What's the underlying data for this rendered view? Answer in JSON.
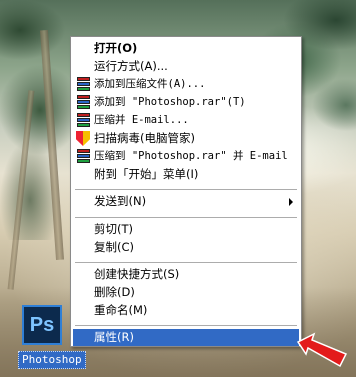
{
  "desktop": {
    "icon": {
      "label": "Photoshop",
      "glyph": "Ps",
      "tile_color": "#0c2a4d",
      "accent": "#2f7fd6"
    }
  },
  "context_menu": {
    "selected_bg": "#316ac5",
    "items": [
      {
        "label": "打开(O)",
        "bold": true,
        "icon": null
      },
      {
        "label": "运行方式(A)...",
        "icon": null
      },
      {
        "label": "添加到压缩文件(A)...",
        "icon": "winrar-icon"
      },
      {
        "label": "添加到 \"Photoshop.rar\"(T)",
        "icon": "winrar-icon"
      },
      {
        "label": "压缩并 E-mail...",
        "icon": "winrar-icon"
      },
      {
        "label": "扫描病毒(电脑管家)",
        "icon": "shield-icon"
      },
      {
        "label": "压缩到 \"Photoshop.rar\" 并 E-mail",
        "icon": "winrar-icon"
      },
      {
        "label": "附到「开始」菜单(I)",
        "icon": null
      },
      {
        "label": "发送到(N)",
        "icon": null,
        "submenu": true
      },
      {
        "label": "剪切(T)",
        "icon": null
      },
      {
        "label": "复制(C)",
        "icon": null
      },
      {
        "label": "创建快捷方式(S)",
        "icon": null
      },
      {
        "label": "删除(D)",
        "icon": null
      },
      {
        "label": "重命名(M)",
        "icon": null
      },
      {
        "label": "属性(R)",
        "icon": null,
        "selected": true
      }
    ]
  }
}
